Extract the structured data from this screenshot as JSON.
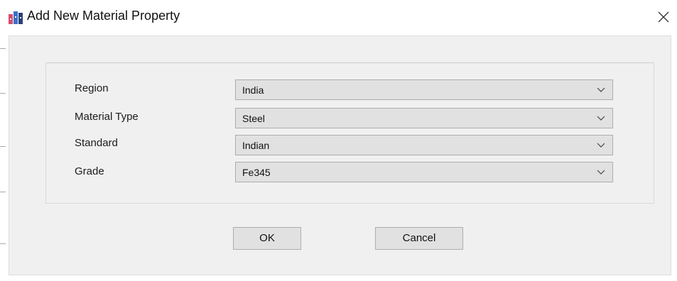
{
  "window": {
    "title": "Add New Material Property"
  },
  "form": {
    "fields": [
      {
        "label": "Region",
        "value": "India"
      },
      {
        "label": "Material Type",
        "value": "Steel"
      },
      {
        "label": "Standard",
        "value": "Indian"
      },
      {
        "label": "Grade",
        "value": "Fe345"
      }
    ]
  },
  "buttons": {
    "ok": "OK",
    "cancel": "Cancel"
  },
  "icons": {
    "app": "app-logo-icon",
    "close": "close-icon",
    "dropdown": "chevron-down-icon"
  },
  "colors": {
    "dialog_background": "#f0f0f0",
    "control_background": "#e1e1e1",
    "control_border": "#adadad"
  }
}
